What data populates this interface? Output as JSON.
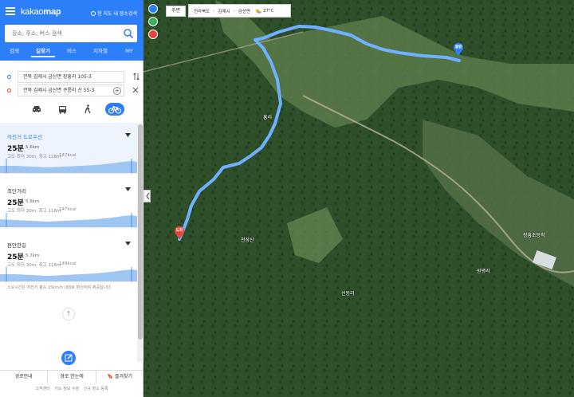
{
  "app": {
    "logo_part1": "kakao",
    "logo_part2": "map",
    "near_places_label": "현 지도 내 장소검색"
  },
  "search": {
    "placeholder": "장소, 주소, 버스 검색"
  },
  "tabs": [
    {
      "label": "검색",
      "active": false
    },
    {
      "label": "길찾기",
      "active": true
    },
    {
      "label": "버스",
      "active": false
    },
    {
      "label": "지하철",
      "active": false
    },
    {
      "label": "MY",
      "active": false
    }
  ],
  "waypoints": {
    "start": "전북 김제시 금산면 장흥리 105-3",
    "end": "전북 김제시 금산면 쿠릉리 산 55-3"
  },
  "modes": [
    {
      "icon": "car-icon",
      "active": false
    },
    {
      "icon": "bus-icon",
      "active": false
    },
    {
      "icon": "walk-icon",
      "active": false
    },
    {
      "icon": "bicycle-icon",
      "active": true
    }
  ],
  "routes": [
    {
      "name": "자전거 도로우선",
      "time": "25분",
      "distance": "5.6km",
      "elevation": "고도 최저 30m, 최고 118m",
      "calories": "147kcal",
      "selected": true
    },
    {
      "name": "최단거리",
      "time": "25분",
      "distance": "5.6km",
      "elevation": "고도 최저 30m, 최고 118m",
      "calories": "147kcal",
      "selected": false
    },
    {
      "name": "편안한길",
      "time": "25분",
      "distance": "5.7km",
      "elevation": "고도 최저 30m, 최고 118m",
      "calories": "149kcal",
      "selected": false
    }
  ],
  "notice": "소요시간은 자전거 평속 15km/h 내외로 환산하여 제공됩니다.",
  "bottom_bar": [
    {
      "label": "경로안내"
    },
    {
      "label": "경로 한눈에"
    },
    {
      "label": "즐겨찾기"
    }
  ],
  "footer": [
    {
      "label": "고객센터"
    },
    {
      "label": "지도 정보 수정"
    },
    {
      "label": "신규 장소 등록"
    }
  ],
  "map": {
    "nearby_label": "주변",
    "location": {
      "province": "전라북도",
      "city": "김제시",
      "district": "금산면"
    },
    "weather": {
      "icon": "sun-cloud-icon",
      "temperature": "27°C"
    },
    "start_marker": "출발",
    "end_marker": "도착",
    "labels": [
      "흥리",
      "천잠산",
      "선동리",
      "장흥초등학",
      "원평리"
    ],
    "colors": {
      "brand": "#2d7ff9",
      "route": "#6fb1ff",
      "end_marker": "#e8453c",
      "pin_blue": "#2d7ff9",
      "pin_green": "#3db159",
      "pin_red": "#e8453c"
    }
  }
}
